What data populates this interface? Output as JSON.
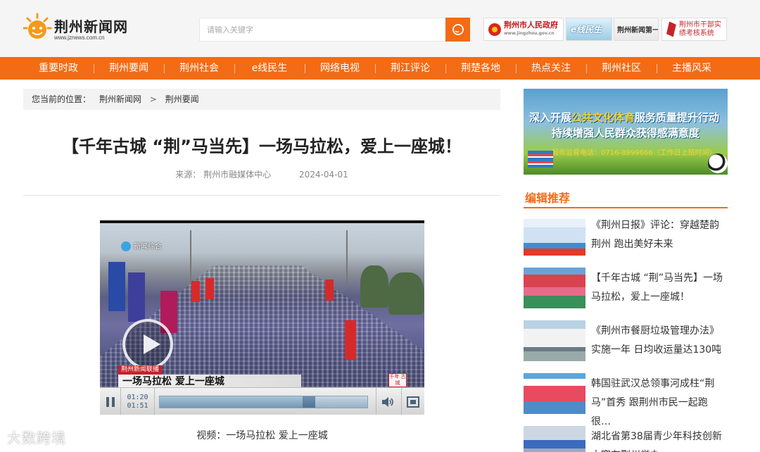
{
  "header": {
    "logo_title": "荆州新闻网",
    "logo_url": "www.jznews.com.cn",
    "search_placeholder": "请输入关键字",
    "partners": [
      {
        "label": "荆州市人民政府",
        "sub": "www.jingzhou.gov.cn"
      },
      {
        "label": "e线民生"
      },
      {
        "label": "荆州新闻第一线"
      },
      {
        "label": "荆州市干部实绩考核系统"
      }
    ]
  },
  "nav": {
    "items": [
      "重要时政",
      "荆州要闻",
      "荆州社会",
      "e线民生",
      "网络电视",
      "荆江评论",
      "荆楚各地",
      "热点关注",
      "荆州社区",
      "主播风采"
    ]
  },
  "breadcrumb": {
    "prefix": "您当前的位置：",
    "items": [
      "荆州新闻网",
      "荆州要闻"
    ],
    "separator": ">"
  },
  "article": {
    "title": "【千年古城 “荆”马当先】一场马拉松，爱上一座城！",
    "source_label": "来源：",
    "source": "荆州市融媒体中心",
    "date": "2024-04-01",
    "video_caption": "视频：一场马拉松 爱上一座城"
  },
  "video": {
    "channel_logo": "新闻综合",
    "tag": "荆州新闻联播",
    "overlay_caption": "一场马拉松 爱上一座城",
    "stamp": "千年 古城",
    "current_time": "01:20",
    "total_time": "01:51",
    "progress": 0.72
  },
  "sidebar": {
    "ad": {
      "line1_a": "深入开展",
      "line1_b": "公共文化体育",
      "line1_c": "服务质量提升行动",
      "line2": "持续增强人民群众获得感满意度",
      "line3": "服务监督电话：0716-8999666（工作日上班时间）"
    },
    "section_title": "编辑推荐",
    "recommendations": [
      {
        "text": "《荆州日报》评论：穿越楚韵荆州 跑出美好未来"
      },
      {
        "text": "【千年古城 “荆”马当先】一场马拉松，爱上一座城！"
      },
      {
        "text": "《荆州市餐厨垃圾管理办法》实施一年 日均收运量达130吨"
      },
      {
        "text": "韩国驻武汉总领事河成柱“荆马”首秀 跟荆州市民一起跑很…"
      },
      {
        "text": "湖北省第38届青少年科技创新大赛在荆州举办"
      }
    ]
  },
  "watermark": "大数跨境",
  "colors": {
    "brand": "#f36b15",
    "nav_text": "#ffffff"
  }
}
